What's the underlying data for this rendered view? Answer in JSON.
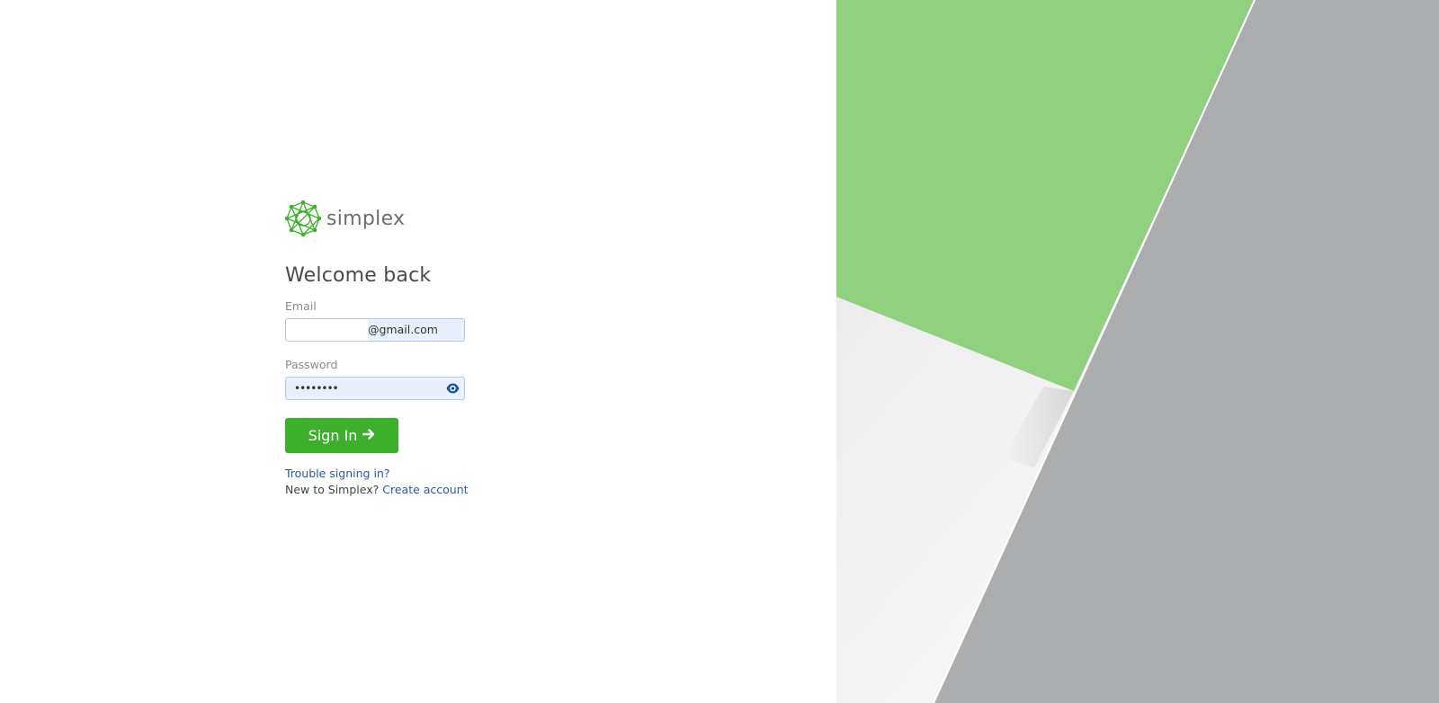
{
  "brand": {
    "name": "simplex",
    "logo_icon": "network-globe-icon",
    "color": "#3daf2c"
  },
  "form": {
    "title": "Welcome back",
    "email_label": "Email",
    "email_value": "@gmail.com",
    "password_label": "Password",
    "password_value": "••••••••",
    "password_toggle_icon": "eye-icon",
    "submit_label": "Sign In",
    "submit_icon": "arrow-right-icon"
  },
  "links": {
    "trouble": "Trouble signing in?",
    "new_prefix": "New to Simplex?",
    "create_account": "Create account"
  },
  "colors": {
    "accent_green": "#3daf2c",
    "panel_green": "#8fd17f",
    "panel_gray": "#acadaf",
    "link_blue": "#2e5a9c",
    "autofill_bg": "#e8f0fe"
  }
}
